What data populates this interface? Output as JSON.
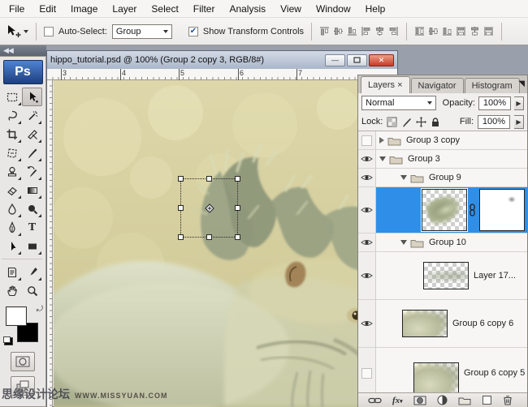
{
  "menu_bar": {
    "items": [
      "File",
      "Edit",
      "Image",
      "Layer",
      "Select",
      "Filter",
      "Analysis",
      "View",
      "Window",
      "Help"
    ]
  },
  "options_bar": {
    "auto_select_label": "Auto-Select:",
    "auto_select_check": "",
    "auto_select_value": "Group",
    "show_transform_label": "Show Transform Controls",
    "show_transform_check": "✔",
    "align_icons": [
      "align-top-edges",
      "align-vertical-centers",
      "align-bottom-edges",
      "align-left-edges",
      "align-horizontal-centers",
      "align-right-edges",
      "distribute-top-edges",
      "distribute-vertical-centers",
      "distribute-bottom-edges",
      "distribute-left-edges",
      "distribute-horizontal-centers",
      "distribute-right-edges"
    ]
  },
  "toolbar": {
    "logo": "Ps",
    "type_tool_glyph": "T",
    "tools": [
      "rectangular-marquee",
      "move",
      "lasso",
      "magic-wand",
      "crop",
      "slice",
      "healing-brush",
      "brush",
      "clone-stamp",
      "history-brush",
      "eraser",
      "gradient",
      "blur",
      "dodge",
      "pen",
      "type",
      "path-selection",
      "rectangle-shape",
      "notes",
      "eyedropper",
      "hand",
      "zoom"
    ]
  },
  "document": {
    "title": "hippo_tutorial.psd @ 100% (Group 2 copy 3, RGB/8#)",
    "minimize_glyph": "—",
    "ruler_numbers": [
      "3",
      "4",
      "5",
      "6",
      "7"
    ],
    "close_glyph": "✕"
  },
  "layers_panel": {
    "tabs": [
      {
        "label": "Layers ×"
      },
      {
        "label": "Navigator"
      },
      {
        "label": "Histogram"
      }
    ],
    "blend_mode": "Normal",
    "opacity_label": "Opacity:",
    "opacity_value": "100%",
    "lock_label": "Lock:",
    "fill_label": "Fill:",
    "fill_value": "100%",
    "rows": [
      {
        "name": "Group 3 copy",
        "type": "group",
        "visible": false,
        "expanded": false
      },
      {
        "name": "Group 3",
        "type": "group",
        "visible": true,
        "expanded": true
      },
      {
        "name": "Group 9",
        "type": "group",
        "visible": true,
        "expanded": true
      },
      {
        "name": "",
        "type": "layer-with-mask",
        "visible": true,
        "selected": true
      },
      {
        "name": "Group 10",
        "type": "group",
        "visible": true,
        "expanded": true
      },
      {
        "name": "Layer 17...",
        "type": "layer",
        "visible": true
      },
      {
        "name": "Group 6 copy 6",
        "type": "layer",
        "visible": true
      },
      {
        "name": "Group 6 copy 5",
        "type": "layer",
        "visible": false
      }
    ]
  },
  "watermark": {
    "cn": "思缘设计论坛",
    "url": "WWW.MISSYUAN.COM"
  },
  "colors": {
    "selection_blue": "#2f8fe8",
    "canvas_bg": "#d7d1a2",
    "workspace_gray": "#9aa0ab",
    "close_red": "#c33b27",
    "ps_logo_blue": "#2a55a0"
  }
}
